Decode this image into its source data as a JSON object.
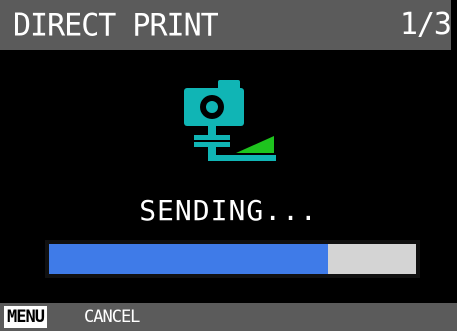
{
  "header": {
    "title": "DIRECT PRINT",
    "page": "1/3"
  },
  "status": {
    "message": "SENDING...",
    "progress_fraction": 0.76
  },
  "footer": {
    "key_label": "MENU",
    "action_label": "CANCEL"
  },
  "icon": {
    "name": "camera-to-printer-transfer-icon"
  },
  "colors": {
    "title_bar": "#5b5b5b",
    "screen_background": "#000000",
    "icon_teal": "#10b5b5",
    "icon_arrow_green": "#1ec41e",
    "progress_fill": "#3f7be8",
    "progress_track": "#d4d4d4"
  }
}
